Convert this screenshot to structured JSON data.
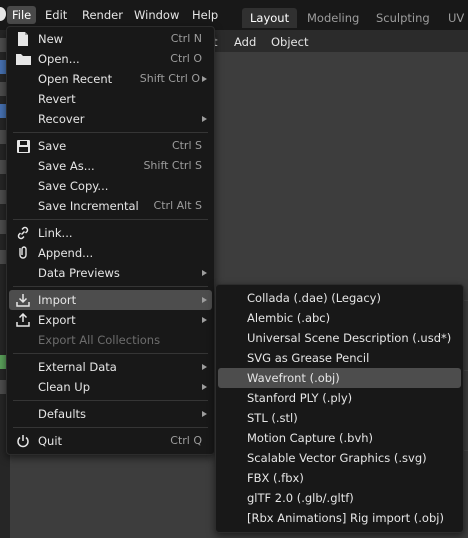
{
  "menubar": {
    "items": [
      "File",
      "Edit",
      "Render",
      "Window",
      "Help"
    ],
    "workspaces": [
      "Layout",
      "Modeling",
      "Sculpting",
      "UV"
    ]
  },
  "viewport_header": {
    "items": [
      "t",
      "Add",
      "Object"
    ]
  },
  "file_menu": {
    "new": {
      "label": "New",
      "shortcut": "Ctrl N"
    },
    "open": {
      "label": "Open...",
      "shortcut": "Ctrl O"
    },
    "open_recent": {
      "label": "Open Recent",
      "shortcut": "Shift Ctrl O"
    },
    "revert": {
      "label": "Revert"
    },
    "recover": {
      "label": "Recover"
    },
    "save": {
      "label": "Save",
      "shortcut": "Ctrl S"
    },
    "save_as": {
      "label": "Save As...",
      "shortcut": "Shift Ctrl S"
    },
    "save_copy": {
      "label": "Save Copy..."
    },
    "save_incremental": {
      "label": "Save Incremental",
      "shortcut": "Ctrl Alt S"
    },
    "link": {
      "label": "Link..."
    },
    "append": {
      "label": "Append..."
    },
    "data_previews": {
      "label": "Data Previews"
    },
    "import": {
      "label": "Import"
    },
    "export": {
      "label": "Export"
    },
    "export_all": {
      "label": "Export All Collections"
    },
    "external_data": {
      "label": "External Data"
    },
    "clean_up": {
      "label": "Clean Up"
    },
    "defaults": {
      "label": "Defaults"
    },
    "quit": {
      "label": "Quit",
      "shortcut": "Ctrl Q"
    }
  },
  "import_menu": {
    "items": [
      "Collada (.dae) (Legacy)",
      "Alembic (.abc)",
      "Universal Scene Description (.usd*)",
      "SVG as Grease Pencil",
      "Wavefront (.obj)",
      "Stanford PLY (.ply)",
      "STL (.stl)",
      "Motion Capture (.bvh)",
      "Scalable Vector Graphics (.svg)",
      "FBX (.fbx)",
      "glTF 2.0 (.glb/.gltf)",
      "[Rbx Animations] Rig import (.obj)"
    ],
    "highlighted": "Wavefront (.obj)"
  },
  "colors": {
    "menu_bg": "#181818",
    "highlight": "#4d4d4d",
    "text": "#e6e6e6",
    "shortcut": "#9d9d9d",
    "disabled": "#6d6d6d"
  }
}
